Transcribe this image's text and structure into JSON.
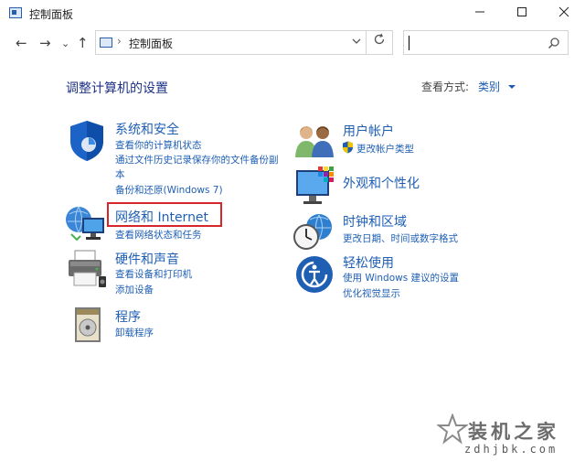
{
  "window": {
    "title": "控制面板"
  },
  "nav": {
    "back": "←",
    "forward": "→",
    "recent": "⌄",
    "up": "↑"
  },
  "address": {
    "path": "控制面板",
    "sep": "›"
  },
  "page": {
    "heading": "调整计算机的设置",
    "view_by_label": "查看方式:",
    "view_by_value": "类别"
  },
  "categories": {
    "system_security": {
      "title": "系统和安全",
      "links": [
        "查看你的计算机状态",
        "通过文件历史记录保存你的文件备份副",
        "本",
        "备份和还原(Windows 7)"
      ]
    },
    "network": {
      "title": "网络和 Internet",
      "links": [
        "查看网络状态和任务"
      ]
    },
    "hardware": {
      "title": "硬件和声音",
      "links": [
        "查看设备和打印机",
        "添加设备"
      ]
    },
    "programs": {
      "title": "程序",
      "links": [
        "卸载程序"
      ]
    },
    "user_accounts": {
      "title": "用户帐户",
      "links": [
        "更改帐户类型"
      ]
    },
    "appearance": {
      "title": "外观和个性化",
      "links": []
    },
    "clock_region": {
      "title": "时钟和区域",
      "links": [
        "更改日期、时间或数字格式"
      ]
    },
    "ease_access": {
      "title": "轻松使用",
      "links": [
        "使用 Windows 建议的设置",
        "优化视觉显示"
      ]
    }
  },
  "highlight_color": "#d6252b",
  "link_color": "#1e5fb4",
  "watermark": {
    "title": "装机之家",
    "url": "zdhjbk.com"
  }
}
